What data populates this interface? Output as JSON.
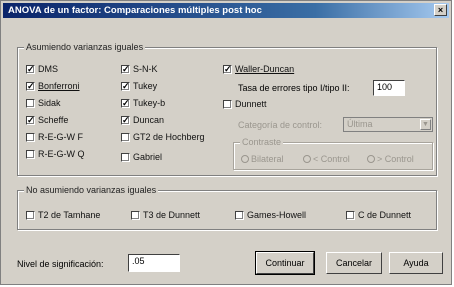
{
  "window": {
    "title": "ANOVA de un factor: Comparaciones múltiples post hoc",
    "close_glyph": "×"
  },
  "equal_variances": {
    "label": "Asumiendo varianzas iguales",
    "options": [
      {
        "label": "DMS",
        "checked": true
      },
      {
        "label": "Bonferroni",
        "checked": true
      },
      {
        "label": "Sidak",
        "checked": false
      },
      {
        "label": "Scheffe",
        "checked": true
      },
      {
        "label": "R-E-G-W F",
        "checked": false
      },
      {
        "label": "R-E-G-W Q",
        "checked": false
      },
      {
        "label": "S-N-K",
        "checked": true
      },
      {
        "label": "Tukey",
        "checked": true
      },
      {
        "label": "Tukey-b",
        "checked": true
      },
      {
        "label": "Duncan",
        "checked": true
      },
      {
        "label": "GT2 de Hochberg",
        "checked": false
      },
      {
        "label": "Gabriel",
        "checked": false
      },
      {
        "label": "Waller-Duncan",
        "checked": true
      },
      {
        "label": "Dunnett",
        "checked": false
      }
    ],
    "ratio_label": "Tasa de errores tipo I/tipo II:",
    "ratio_value": "100",
    "control_label": "Categoría de control:",
    "control_value": "Última",
    "test_label": "Contraste",
    "test_options": [
      "Bilateral",
      "< Control",
      "> Control"
    ]
  },
  "unequal_variances": {
    "label": "No asumiendo varianzas iguales",
    "options": [
      {
        "label": "T2 de Tamhane",
        "checked": false
      },
      {
        "label": "T3 de Dunnett",
        "checked": false
      },
      {
        "label": "Games-Howell",
        "checked": false
      },
      {
        "label": "C de Dunnett",
        "checked": false
      }
    ]
  },
  "significance": {
    "label": "Nivel de significación:",
    "value": ".05"
  },
  "buttons": {
    "continue": "Continuar",
    "cancel": "Cancelar",
    "help": "Ayuda"
  },
  "check_glyph": "✓"
}
